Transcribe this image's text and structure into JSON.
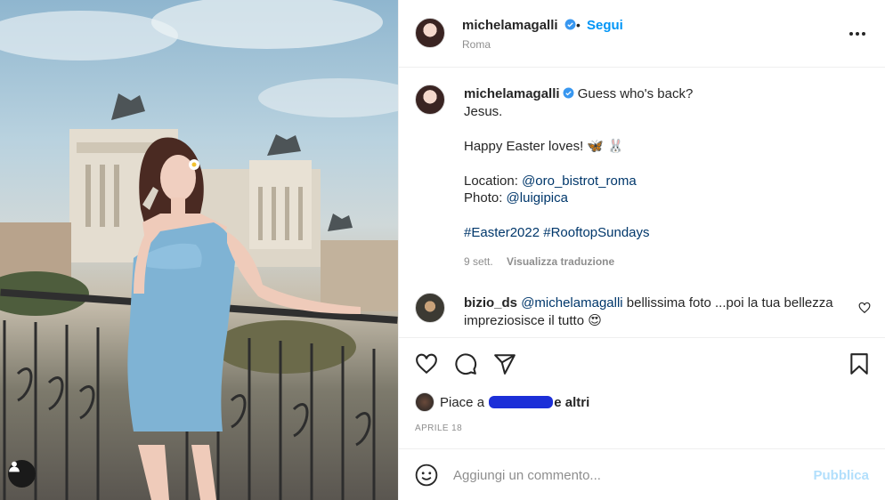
{
  "post_header": {
    "username": "michelamagalli",
    "separator": "•",
    "follow_label": "Segui",
    "location": "Roma"
  },
  "caption": {
    "username": "michelamagalli",
    "lines": [
      "Guess who's back?",
      "Jesus.",
      "",
      "Happy Easter loves! 🦋 🐰",
      ""
    ],
    "location_label": "Location:",
    "location_handle": "@oro_bistrot_roma",
    "photo_label": "Photo:",
    "photo_handle": "@luigipica",
    "hashtag_1": "#Easter2022",
    "hashtag_2": "#RooftopSundays",
    "time_ago": "9 sett.",
    "translate_label": "Visualizza traduzione"
  },
  "comment": {
    "username": "bizio_ds",
    "mention": "@michelamagalli",
    "text": "bellissima foto ...poi la tua bellezza impreziosisce il tutto 😍"
  },
  "likes": {
    "prefix": "Piace a",
    "suffix": "e altri"
  },
  "date": "APRILE 18",
  "add_comment": {
    "placeholder": "Aggiungi un commento...",
    "publish_label": "Pubblica"
  },
  "icons": {
    "verified": "verified-badge-icon",
    "more": "more-options-icon",
    "like": "heart-icon",
    "comment": "comment-icon",
    "share": "share-icon",
    "save": "bookmark-icon",
    "emoji": "emoji-icon",
    "tag": "user-tag-icon"
  },
  "colors": {
    "accent_blue": "#0095f6",
    "link_blue": "#00376b",
    "muted": "#8e8e8e",
    "publish_disabled": "#b2dffc"
  }
}
